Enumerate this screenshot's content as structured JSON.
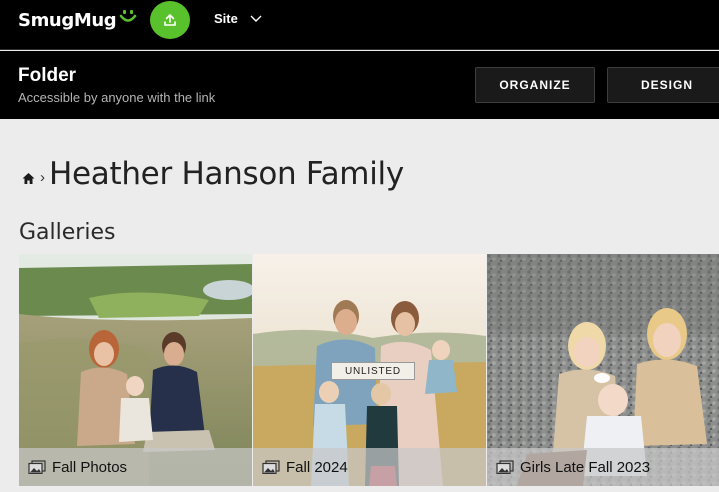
{
  "topbar": {
    "logo_text": "SmugMug",
    "site_label": "Site"
  },
  "folder": {
    "title": "Folder",
    "subtitle": "Accessible by anyone with the link",
    "organize_label": "ORGANIZE",
    "design_label": "DESIGN"
  },
  "page": {
    "title": "Heather Hanson Family",
    "section_title": "Galleries"
  },
  "galleries": [
    {
      "title": "Fall Photos",
      "badge": ""
    },
    {
      "title": "Fall 2024",
      "badge": "UNLISTED"
    },
    {
      "title": "Girls Late Fall 2023",
      "badge": ""
    }
  ],
  "colors": {
    "accent": "#59c12b",
    "topbar": "#000000",
    "page_bg": "#ececec"
  }
}
